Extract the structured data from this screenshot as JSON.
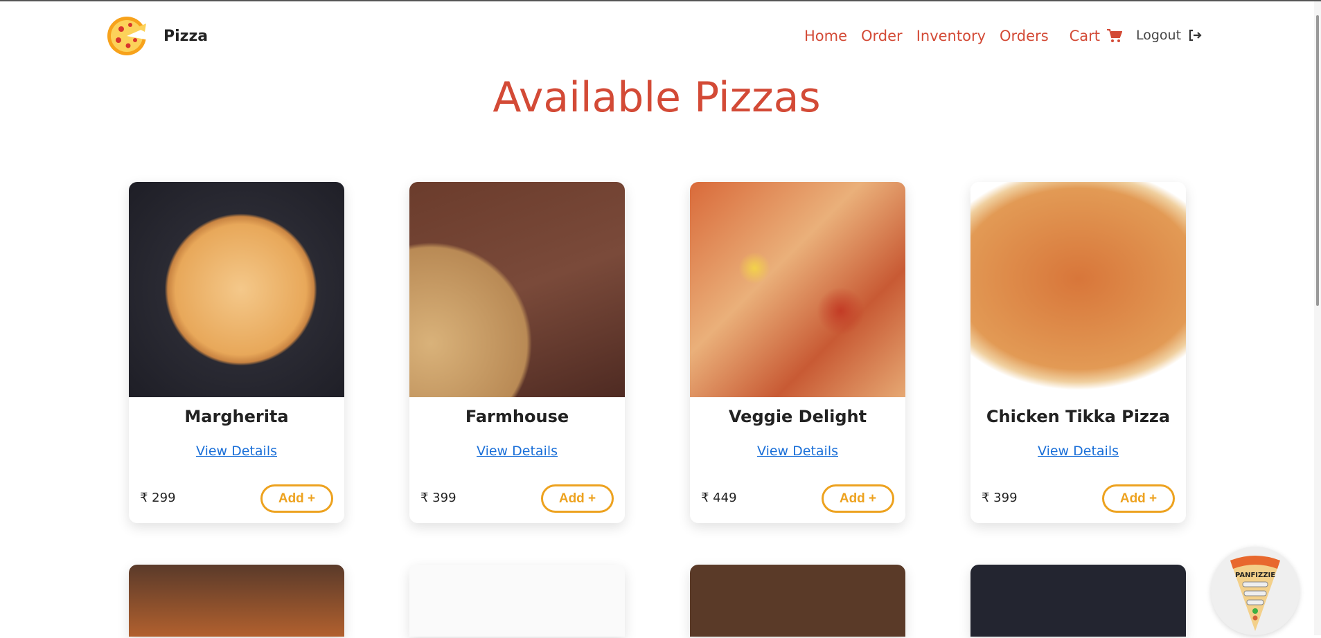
{
  "header": {
    "brand": "Pizza",
    "nav": [
      "Home",
      "Order",
      "Inventory",
      "Orders"
    ],
    "cart": "Cart",
    "logout": "Logout"
  },
  "page_title": "Available Pizzas",
  "pizzas": [
    {
      "name": "Margherita",
      "details": "View Details",
      "price": "₹ 299",
      "add": "Add +"
    },
    {
      "name": "Farmhouse",
      "details": "View Details",
      "price": "₹ 399",
      "add": "Add +"
    },
    {
      "name": "Veggie Delight",
      "details": "View Details",
      "price": "₹ 449",
      "add": "Add +"
    },
    {
      "name": "Chicken Tikka Pizza",
      "details": "View Details",
      "price": "₹ 399",
      "add": "Add +"
    }
  ],
  "widget": {
    "label": "PANFIZZIE"
  },
  "colors": {
    "accent": "#d34a36",
    "button": "#eda21f",
    "link": "#1a6fd8"
  }
}
